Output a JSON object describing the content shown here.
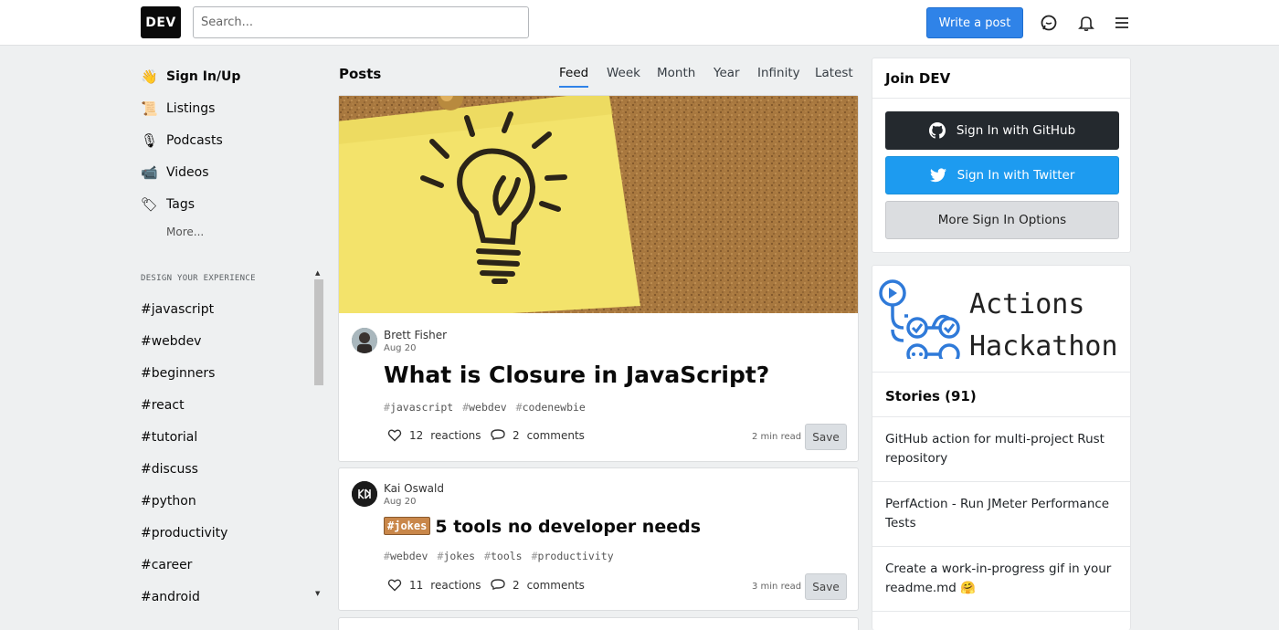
{
  "header": {
    "logo": "DEV",
    "search_placeholder": "Search...",
    "write_post": "Write a post"
  },
  "sidebar": {
    "items": [
      {
        "emoji": "👋",
        "label": "Sign In/Up"
      },
      {
        "emoji": "📜",
        "label": "Listings"
      },
      {
        "emoji": "🎙",
        "label": "Podcasts"
      },
      {
        "emoji": "📹",
        "label": "Videos"
      },
      {
        "emoji": "🏷",
        "label": "Tags"
      }
    ],
    "more": "More...",
    "design_title": "DESIGN YOUR EXPERIENCE",
    "tags": [
      "#javascript",
      "#webdev",
      "#beginners",
      "#react",
      "#tutorial",
      "#discuss",
      "#python",
      "#productivity",
      "#career",
      "#android"
    ]
  },
  "feed": {
    "title": "Posts",
    "filters": [
      "Feed",
      "Week",
      "Month",
      "Year",
      "Infinity",
      "Latest"
    ],
    "active_filter": "Feed",
    "posts": [
      {
        "author": "Brett Fisher",
        "date": "Aug 20",
        "title": "What is Closure in JavaScript?",
        "tags": [
          "javascript",
          "webdev",
          "codenewbie"
        ],
        "reactions_count": "12",
        "reactions_label": "reactions",
        "comments_count": "2",
        "comments_label": "comments",
        "read_time": "2 min read",
        "save": "Save"
      },
      {
        "author": "Kai Oswald",
        "date": "Aug 20",
        "badge": "#jokes",
        "title": "5 tools no developer needs",
        "tags": [
          "webdev",
          "jokes",
          "tools",
          "productivity"
        ],
        "reactions_count": "11",
        "reactions_label": "reactions",
        "comments_count": "2",
        "comments_label": "comments",
        "read_time": "3 min read",
        "save": "Save"
      }
    ]
  },
  "right": {
    "join_title": "Join DEV",
    "github_btn": "Sign In with GitHub",
    "twitter_btn": "Sign In with Twitter",
    "more_btn": "More Sign In Options",
    "hackathon_line1": "Actions",
    "hackathon_line2": "Hackathon",
    "stories_title": "Stories (91)",
    "stories": [
      "GitHub action for multi-project Rust repository",
      "PerfAction - Run JMeter Performance Tests",
      "Create a work-in-progress gif in your readme.md 🤗"
    ]
  },
  "colors": {
    "accent": "#2f83e8",
    "github": "#24292e",
    "twitter": "#1d9bf0"
  }
}
